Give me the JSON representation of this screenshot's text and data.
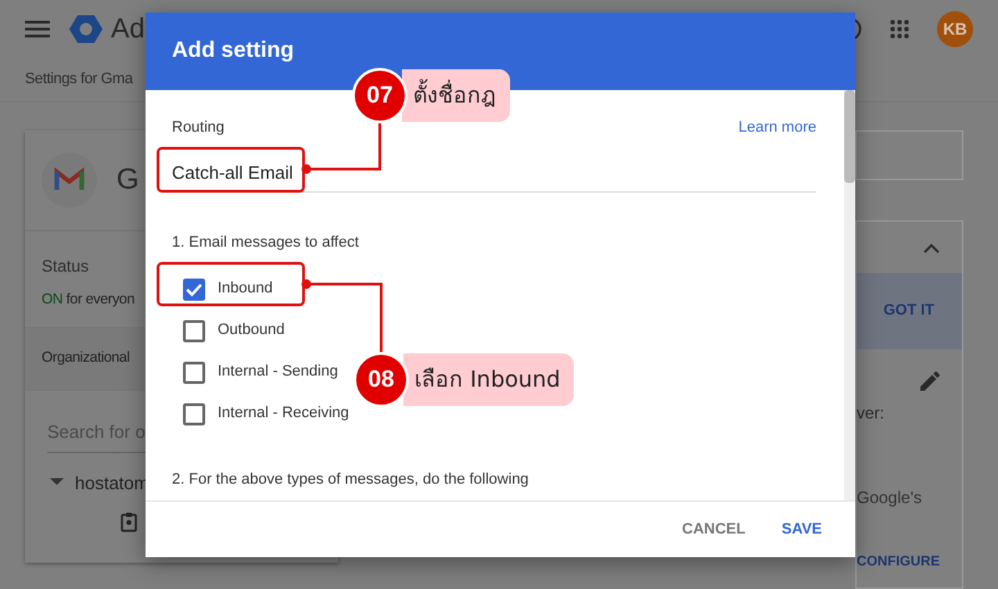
{
  "app_bar": {
    "product": "Ad",
    "avatar": "KB"
  },
  "breadcrumb": "Settings for Gma",
  "left_card": {
    "service_initial": "G",
    "status_label": "Status",
    "status_on": "ON",
    "status_rest": "for everyon",
    "org_units": "Organizational",
    "search": {
      "placeholder": "Search for o"
    },
    "tree_item": "hostatom"
  },
  "right_panel": {
    "got_it": "GOT IT",
    "text_1": "ver:",
    "text_2": "Google's",
    "configure": "CONFIGURE"
  },
  "dialog": {
    "title": "Add setting",
    "section": "Routing",
    "learn_more": "Learn more",
    "name_field": {
      "value": "Catch-all Email"
    },
    "step_1": "1. Email messages to affect",
    "options": [
      {
        "label": "Inbound",
        "checked": true
      },
      {
        "label": "Outbound",
        "checked": false
      },
      {
        "label": "Internal - Sending",
        "checked": false
      },
      {
        "label": "Internal - Receiving",
        "checked": false
      }
    ],
    "step_2": "2. For the above types of messages, do the following",
    "buttons": [
      {
        "label": "CANCEL",
        "kind": "secondary"
      },
      {
        "label": "SAVE",
        "kind": "primary"
      }
    ]
  },
  "callouts": [
    {
      "number": "07",
      "text": "ตั้งชื่อกฎ"
    },
    {
      "number": "08",
      "text": "เลือก Inbound"
    }
  ]
}
